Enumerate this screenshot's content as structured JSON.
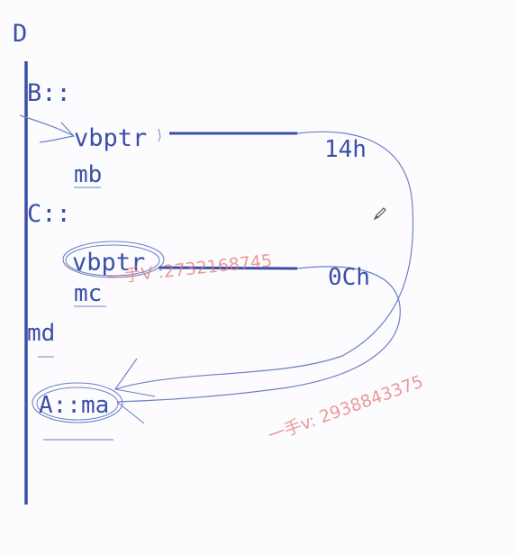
{
  "diagram": {
    "class_name": "D",
    "sections": [
      {
        "label": "B::",
        "vbptr": "vbptr",
        "member": "mb",
        "offset": "14h"
      },
      {
        "label": "C::",
        "vbptr": "vbptr",
        "member": "mc",
        "offset": "0Ch"
      }
    ],
    "own_member": "md",
    "virtual_base_member": "A::ma"
  },
  "watermarks": {
    "first": "一手V :2732168745",
    "second": "一手v: 2938843375"
  },
  "colors": {
    "ink": "#3a4fa6",
    "thin_ink": "#6d80c6",
    "watermark": "#e67878"
  },
  "icons": {
    "cursor": "pencil-icon"
  }
}
